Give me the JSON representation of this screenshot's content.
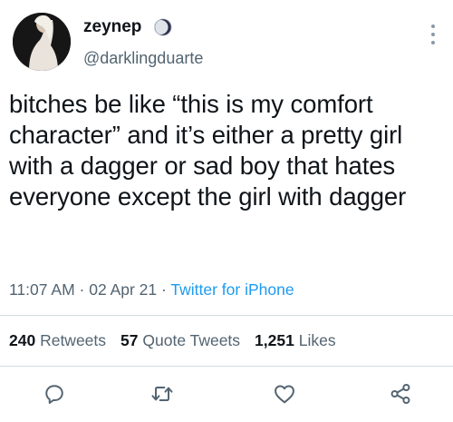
{
  "tweet": {
    "display_name": "zeynep",
    "handle": "@darklingduarte",
    "verified_icon": "moon-icon",
    "text": "bitches be like “this is my comfort character” and it’s either a pretty girl with a dagger or sad boy that hates everyone except the girl with dagger",
    "time": "11:07 AM",
    "date": "02 Apr 21",
    "separator": "·",
    "source": "Twitter for iPhone"
  },
  "stats": {
    "retweets_count": "240",
    "retweets_label": "Retweets",
    "quote_count": "57",
    "quote_label": "Quote Tweets",
    "likes_count": "1,251",
    "likes_label": "Likes"
  },
  "actions": [
    "reply-icon",
    "retweet-icon",
    "like-icon",
    "share-icon"
  ],
  "colors": {
    "text": "#0f1419",
    "secondary": "#536471",
    "link": "#1d9bf0",
    "divider": "#d4dadf"
  }
}
